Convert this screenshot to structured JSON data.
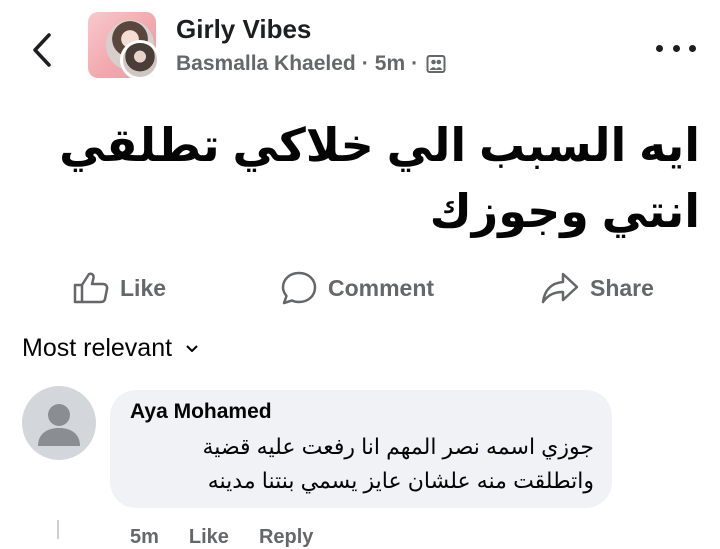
{
  "header": {
    "group_name": "Girly Vibes",
    "author": "Basmalla Khaeled",
    "separator": "·",
    "time": "5m",
    "icons": {
      "back": "chevron-left-icon",
      "privacy": "members-icon",
      "more": "more-dots-icon"
    }
  },
  "post": {
    "text": "ايه السبب الي خلاكي تطلقي انتي وجوزك"
  },
  "actions": [
    {
      "label": "Like",
      "icon": "thumbs-up-icon"
    },
    {
      "label": "Comment",
      "icon": "comment-bubble-icon"
    },
    {
      "label": "Share",
      "icon": "share-arrow-icon"
    }
  ],
  "comments": {
    "sort_label": "Most relevant",
    "items": [
      {
        "author": "Aya Mohamed",
        "text": "جوزي اسمه نصر المهم انا رفعت عليه قضية واتطلقت منه علشان عايز يسمي بنتنا مدينه",
        "time": "5m",
        "like_label": "Like",
        "reply_label": "Reply"
      }
    ]
  },
  "colors": {
    "text_primary": "#050505",
    "text_secondary": "#65676b",
    "bubble_bg": "#f0f2f5",
    "avatar_placeholder": "#d3d6da"
  }
}
